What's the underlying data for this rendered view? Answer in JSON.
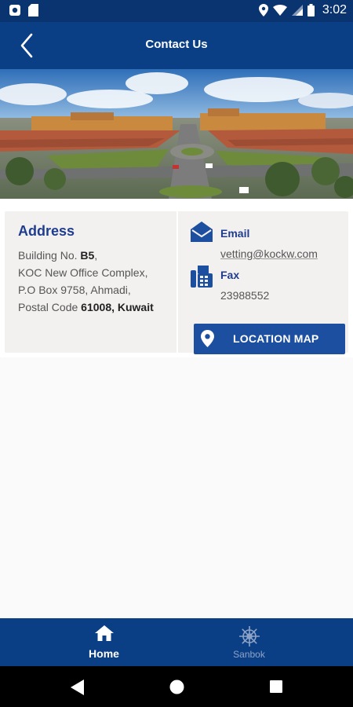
{
  "status_bar": {
    "time": "3:02"
  },
  "app_bar": {
    "title": "Contact Us"
  },
  "address": {
    "heading": "Address",
    "line1_prefix": "Building No. ",
    "line1_bold": "B5",
    "line1_suffix": ",",
    "line2": "KOC New Office Complex,",
    "line3": "P.O Box 9758, Ahmadi,",
    "line4_prefix": "Postal Code ",
    "line4_bold": "61008, Kuwait"
  },
  "contact": {
    "email_label": "Email",
    "email_value": "vetting@kockw.com",
    "fax_label": "Fax",
    "fax_value": "23988552",
    "location_button": "LOCATION MAP"
  },
  "bottom_nav": {
    "items": [
      {
        "label": "Home"
      },
      {
        "label": "Sanbok"
      }
    ]
  },
  "colors": {
    "primary": "#0a3f85",
    "accent": "#1d4fa0",
    "heading": "#1f3d8f"
  },
  "icons": [
    "back-arrow-icon",
    "envelope-icon",
    "fax-icon",
    "map-pin-icon",
    "home-icon",
    "ship-wheel-icon"
  ]
}
